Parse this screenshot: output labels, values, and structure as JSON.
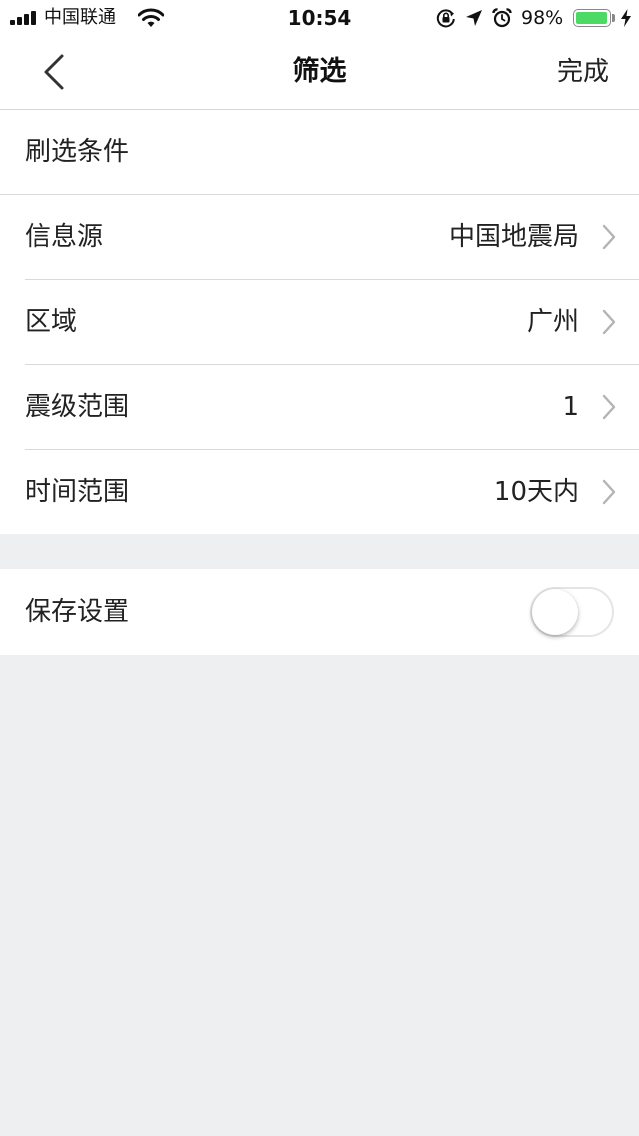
{
  "status_bar": {
    "carrier": "中国联通",
    "time": "10:54",
    "battery_percent": "98%",
    "battery_level": 0.98,
    "icons": [
      "signal-icon",
      "wifi-icon",
      "rotation-lock-icon",
      "location-icon",
      "alarm-icon",
      "battery-icon",
      "charging-bolt-icon"
    ]
  },
  "nav": {
    "back_icon": "chevron-left-icon",
    "title": "筛选",
    "done_label": "完成"
  },
  "filter": {
    "section_header": "刷选条件",
    "rows": [
      {
        "label": "信息源",
        "value": "中国地震局"
      },
      {
        "label": "区域",
        "value": "广州"
      },
      {
        "label": "震级范围",
        "value": "1"
      },
      {
        "label": "时间范围",
        "value": "10天内"
      }
    ],
    "chevron_icon": "chevron-right-icon"
  },
  "save": {
    "label": "保存设置",
    "toggle_on": false
  },
  "colors": {
    "background": "#edeff1",
    "surface": "#ffffff",
    "battery_green": "#4cd964",
    "chevron": "#b3b3b3",
    "divider": "#d9d9d9"
  }
}
